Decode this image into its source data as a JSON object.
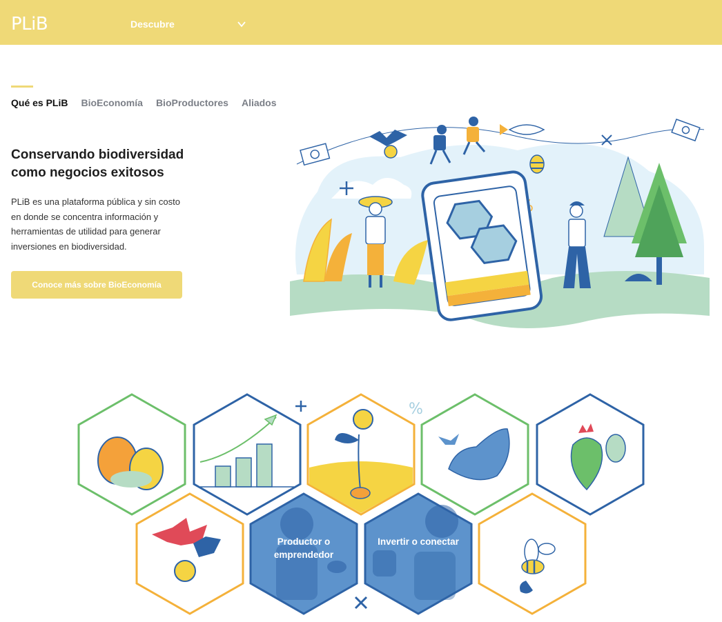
{
  "header": {
    "logo": "PLiB",
    "nav_label": "Descubre"
  },
  "tabs": [
    {
      "label": "Qué es PLiB",
      "active": true
    },
    {
      "label": "BioEconomía",
      "active": false
    },
    {
      "label": "BioProductores",
      "active": false
    },
    {
      "label": "Aliados",
      "active": false
    }
  ],
  "hero": {
    "title": "Conservando biodiversidad como negocios exitosos",
    "description": "PLiB es una plataforma pública y sin costo en donde se concentra información y herramientas de utilidad para generar inversiones en biodiversidad.",
    "cta_label": "Conoce más sobre BioEconomía"
  },
  "hexagons": {
    "producer_label": "Productor o emprendedor",
    "investor_label": "Invertir o conectar",
    "tiles": [
      "squash-icon",
      "growth-chart-icon",
      "seedling-sun-icon",
      "whale-icon",
      "cactus-fruit-icon",
      "bat-coin-icon",
      "producer-person-icon",
      "investor-person-icon",
      "bee-icon"
    ]
  },
  "colors": {
    "brand_yellow": "#efd977",
    "green": "#6cbf6a",
    "blue": "#2e63a6",
    "orange": "#f4b13a"
  }
}
